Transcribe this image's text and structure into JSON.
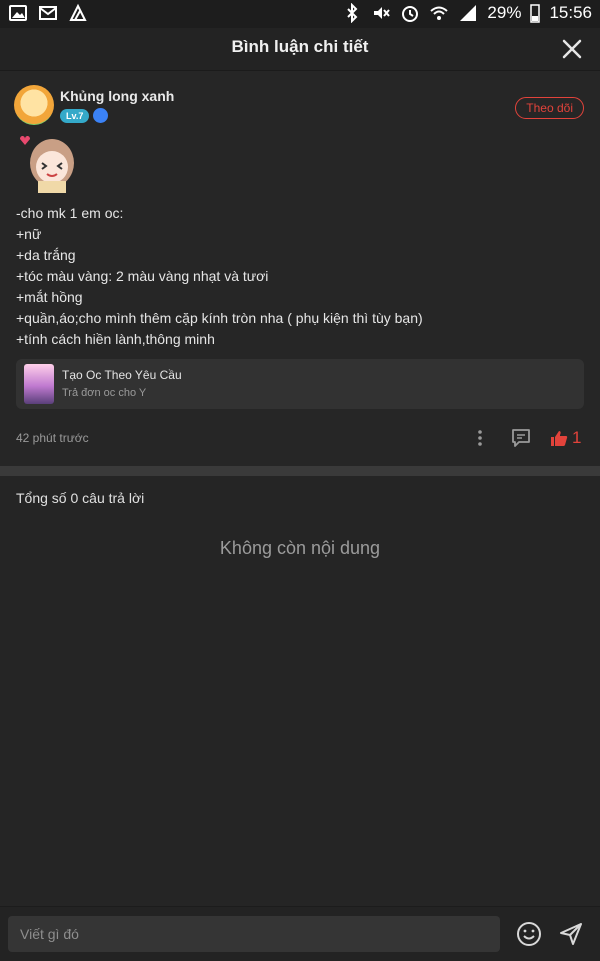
{
  "status_bar": {
    "battery": "29%",
    "time": "15:56",
    "left_icons": [
      "gallery-icon",
      "email-icon",
      "app-icon"
    ],
    "right_icons": [
      "bluetooth-icon",
      "mute-icon",
      "alarm-icon",
      "wifi-icon",
      "signal-icon",
      "battery-icon"
    ]
  },
  "header": {
    "title": "Bình luận chi tiết",
    "close_icon": "close-icon"
  },
  "post": {
    "username": "Khủng long xanh",
    "level": "Lv.7",
    "follow_label": "Theo dõi",
    "content_lines": [
      "-cho mk 1 em oc:",
      "+nữ",
      "+da trắng",
      "+tóc màu vàng: 2 màu vàng nhạt và tươi",
      "+mắt hồng",
      "+quần,áo;cho mình thêm cặp kính tròn nha ( phụ kiện thì tùy bạn)",
      "+tính cách hiền lành,thông minh"
    ],
    "link": {
      "title": "Tạo Oc Theo Yêu Cầu",
      "subtitle": "Trả đơn oc cho Y"
    },
    "timestamp": "42 phút trước",
    "like_count": "1"
  },
  "replies": {
    "total_label": "Tổng số 0 câu trả lời",
    "empty_label": "Không còn nội dung"
  },
  "composer": {
    "placeholder": "Viết gì đó"
  },
  "colors": {
    "accent": "#e2433b",
    "background": "#252525",
    "card": "#323232"
  }
}
